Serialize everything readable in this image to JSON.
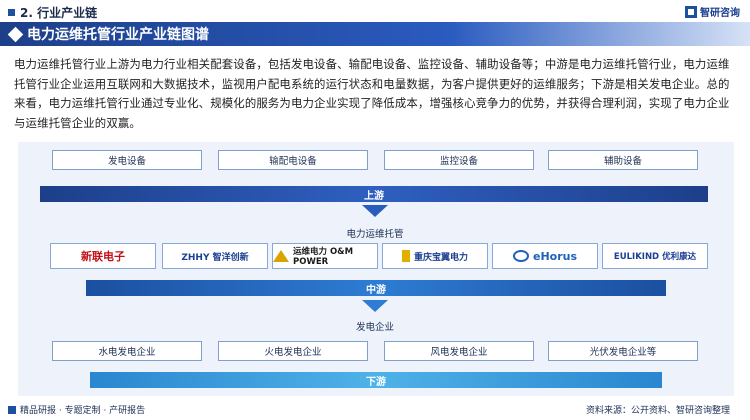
{
  "header": {
    "section": "2. 行业产业链",
    "logo_text": "智研咨询"
  },
  "title": "电力运维托管行业产业链图谱",
  "paragraph": "电力运维托管行业上游为电力行业相关配套设备，包括发电设备、输配电设备、监控设备、辅助设备等；中游是电力运维托管行业，电力运维托管行业企业运用互联网和大数据技术，监视用户配电系统的运行状态和电量数据，为客户提供更好的运维服务；下游是相关发电企业。总的来看，电力运维托管行业通过专业化、规模化的服务为电力企业实现了降低成本，增强核心竞争力的优势，并获得合理利润，实现了电力企业与运维托管企业的双赢。",
  "upstream": {
    "items": [
      "发电设备",
      "输配电设备",
      "监控设备",
      "辅助设备"
    ],
    "stage": "上游"
  },
  "midstream": {
    "label": "电力运维托管",
    "companies": [
      "新联电子",
      "ZHHY 智洋创新",
      "运维电力 O&M POWER",
      "重庆宝翼电力",
      "eHorus",
      "EULIKIND 优利康达"
    ],
    "stage": "中游"
  },
  "downstream": {
    "label": "发电企业",
    "items": [
      "水电发电企业",
      "火电发电企业",
      "风电发电企业",
      "光伏发电企业等"
    ],
    "stage": "下游"
  },
  "footer": {
    "left": "精品研报 · 专题定制 · 产研报告",
    "right": "资料来源：公开资料、智研咨询整理"
  },
  "colors": {
    "primary": "#1f4fa0",
    "panel_bg": "#eef3fb"
  }
}
